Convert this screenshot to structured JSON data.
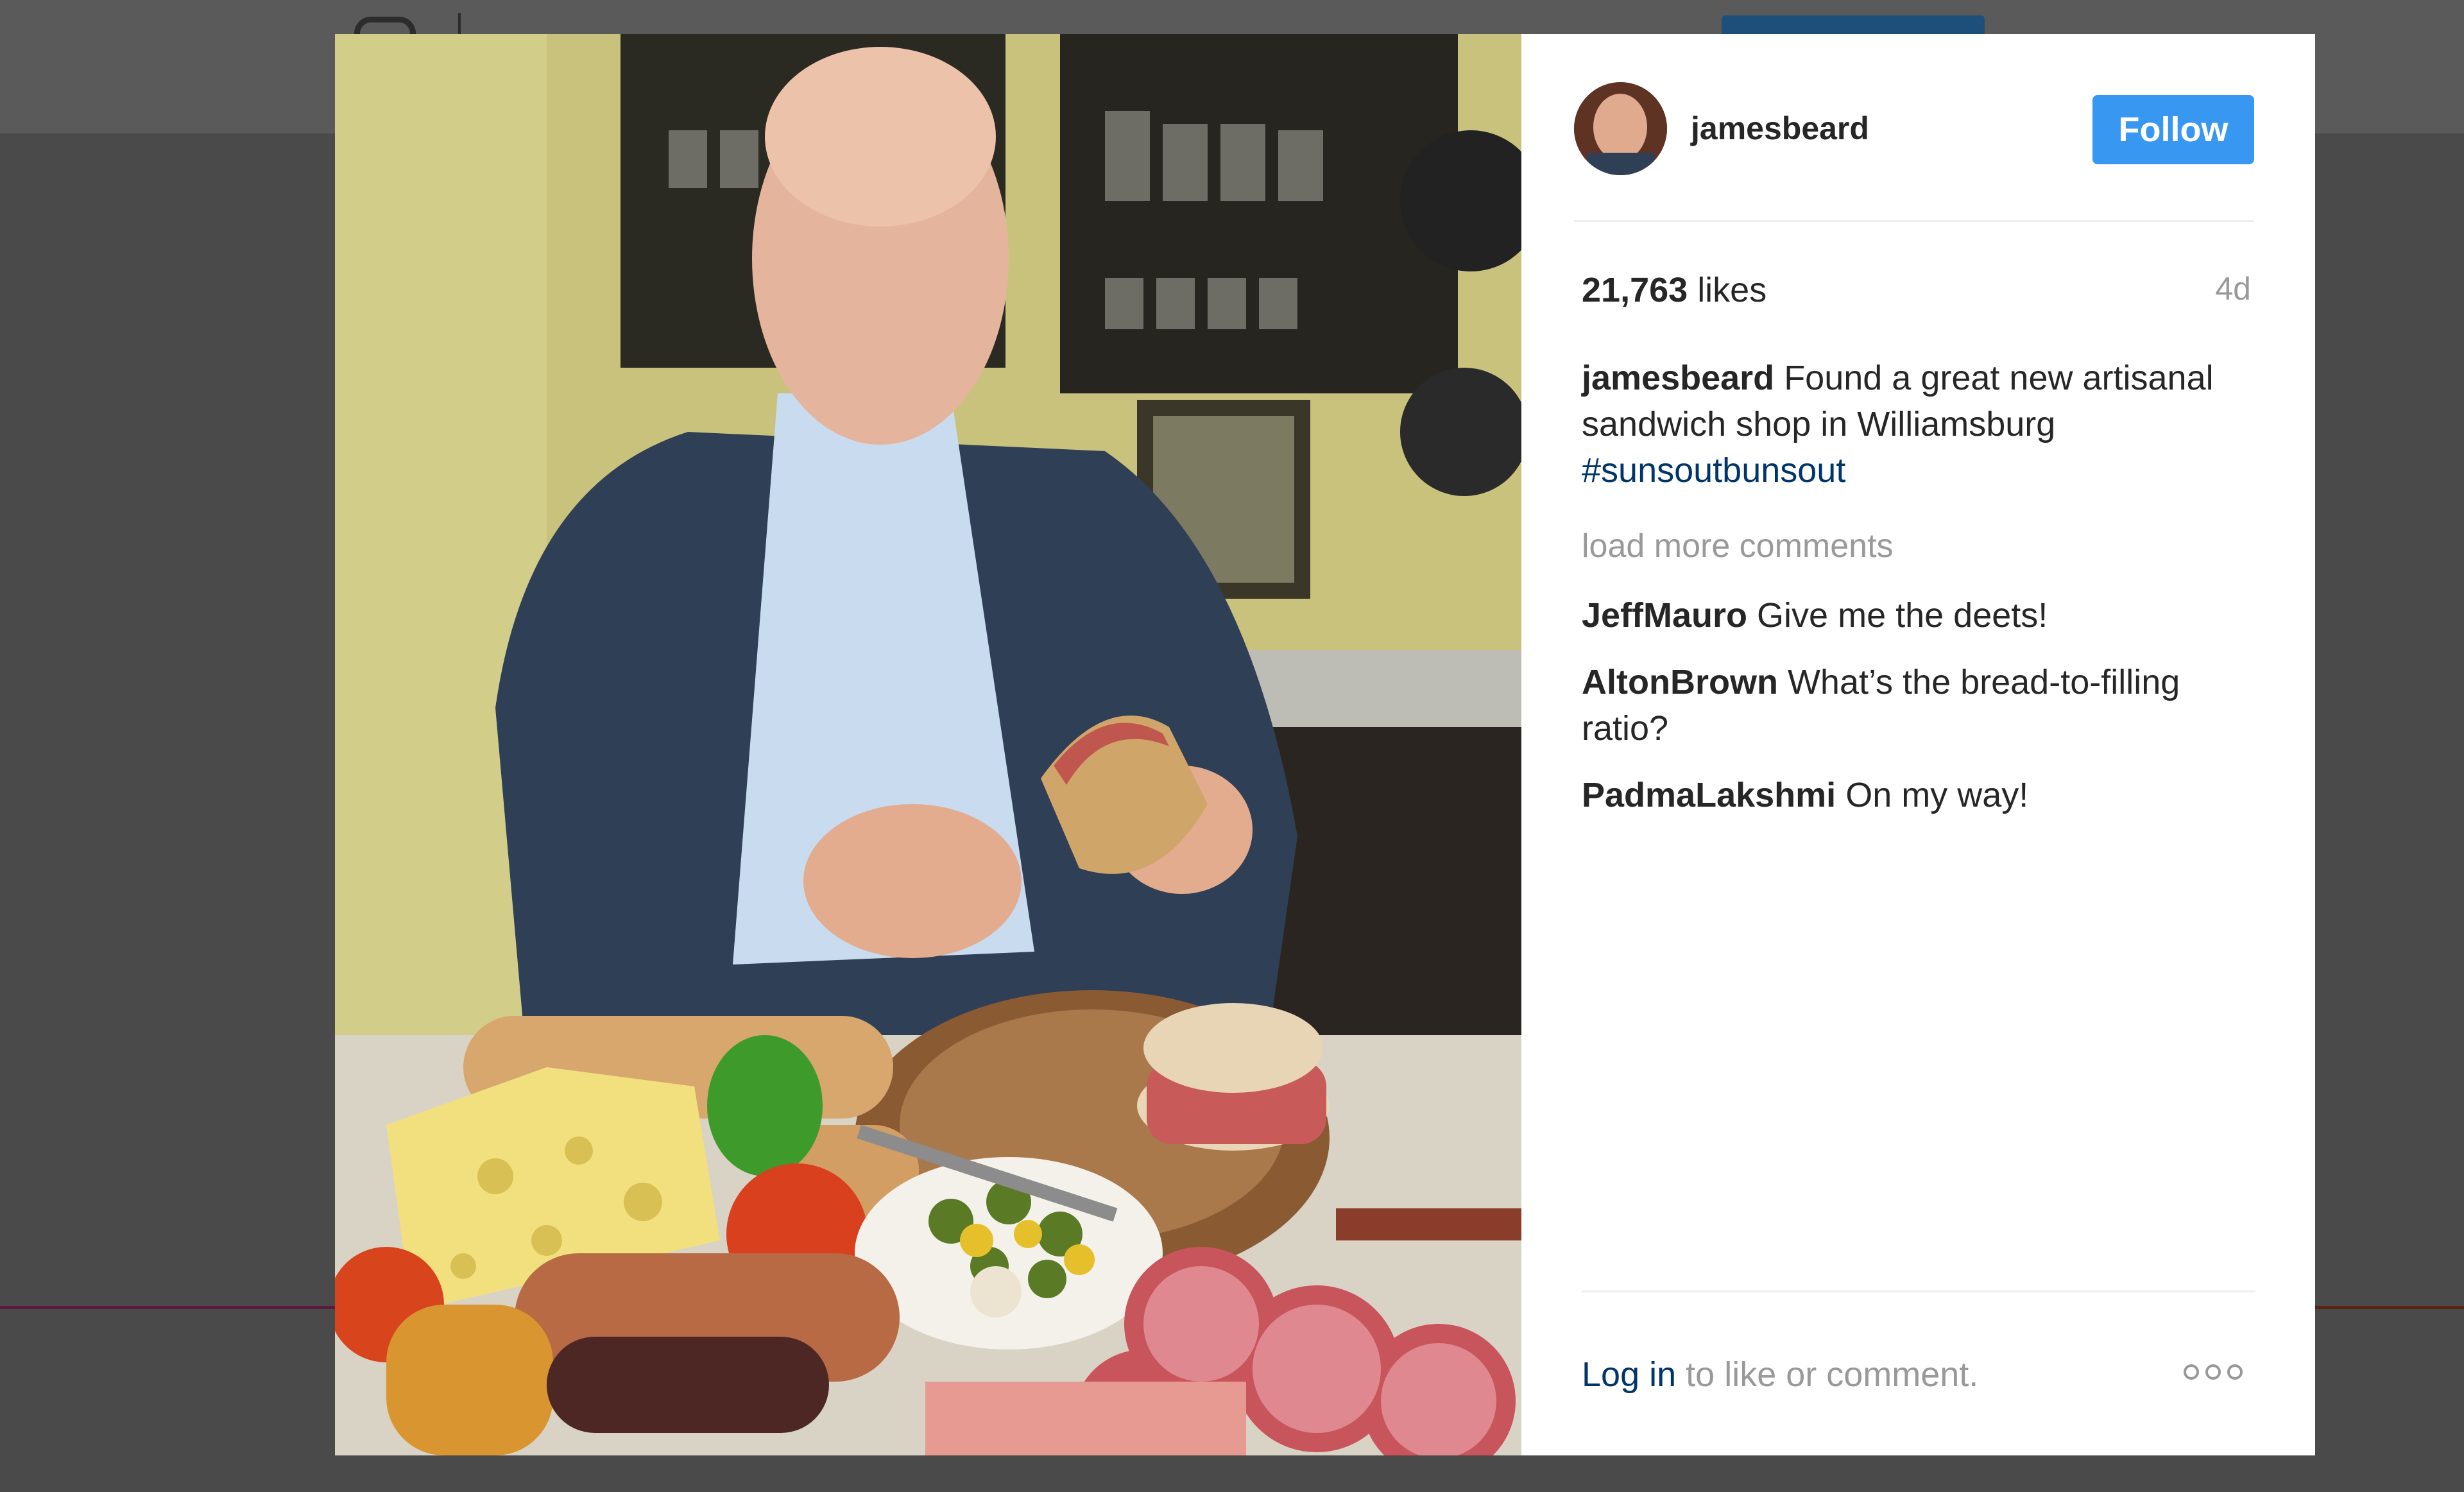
{
  "page": {
    "background_color": "#4b4b4b"
  },
  "post": {
    "username": "jamesbeard",
    "follow_label": "Follow",
    "likes_count": "21,763",
    "likes_label": "likes",
    "time_ago": "4d",
    "caption_user": "jamesbeard",
    "caption_text": "Found a great new artisanal sandwich shop in Williamsburg",
    "caption_hashtag": "#sunsoutbunsout",
    "load_more_label": "load more comments",
    "comments": [
      {
        "user": "JeffMauro",
        "text": "Give me the deets!"
      },
      {
        "user": "AltonBrown",
        "text": "What’s the bread-to-filling ratio?"
      },
      {
        "user": "PadmaLakshmi",
        "text": "On my way!"
      }
    ],
    "login_link": "Log in",
    "login_suffix": "to like or comment.",
    "more_icon": "more-options-icon"
  },
  "colors": {
    "follow_button": "#3897f0",
    "link": "#003569",
    "muted_text": "#999999"
  }
}
